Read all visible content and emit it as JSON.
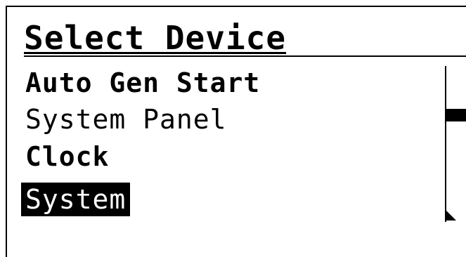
{
  "screen": {
    "title": "Select Device"
  },
  "menu": {
    "items": [
      {
        "label": "Auto Gen Start",
        "style": "bold"
      },
      {
        "label": "System Panel",
        "style": "plain"
      },
      {
        "label": "Clock",
        "style": "bold"
      },
      {
        "label": "System",
        "style": "selected"
      }
    ],
    "selected_index": 3
  },
  "scrollbar": {
    "position": 0.25,
    "down_arrow_icon": "triangle-down-right-icon"
  },
  "colors": {
    "foreground": "#000000",
    "background": "#ffffff"
  }
}
